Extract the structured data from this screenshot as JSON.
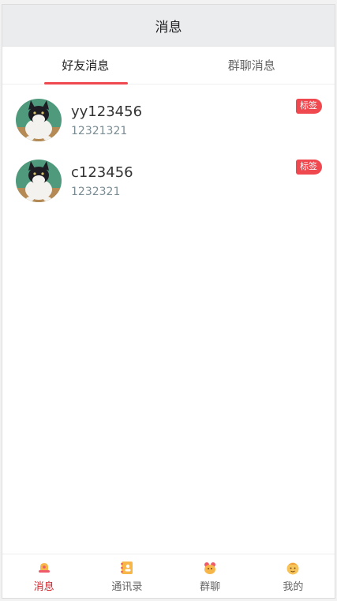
{
  "navbar": {
    "title": "消息"
  },
  "tabs": [
    {
      "label": "好友消息",
      "active": true
    },
    {
      "label": "群聊消息",
      "active": false
    }
  ],
  "messages": [
    {
      "name": "yy123456",
      "sub": "12321321",
      "badge": "标签"
    },
    {
      "name": "c123456",
      "sub": "1232321",
      "badge": "标签"
    }
  ],
  "tabbar": [
    {
      "label": "消息",
      "icon": "message-bell-icon",
      "active": true
    },
    {
      "label": "通讯录",
      "icon": "contacts-book-icon",
      "active": false
    },
    {
      "label": "群聊",
      "icon": "group-chat-icon",
      "active": false
    },
    {
      "label": "我的",
      "icon": "profile-face-icon",
      "active": false
    }
  ],
  "colors": {
    "accent": "#f0484f",
    "active_tab_label": "#d0232a",
    "navbar_bg": "#ebecee"
  }
}
